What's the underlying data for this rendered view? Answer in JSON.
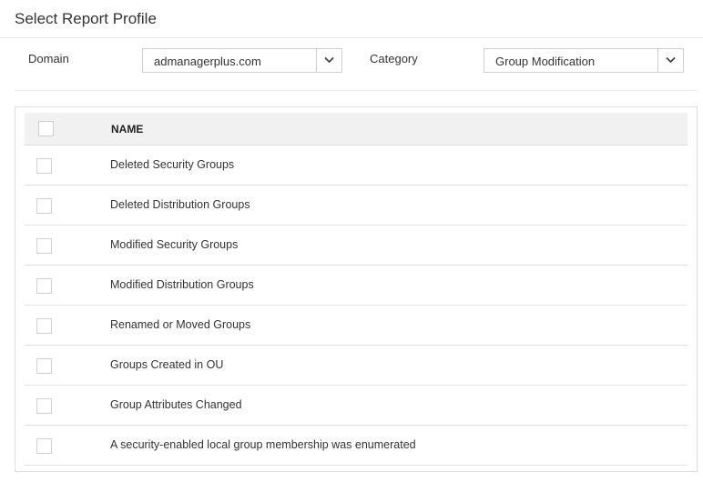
{
  "header": {
    "title": "Select Report Profile"
  },
  "filters": {
    "domain_label": "Domain",
    "domain_value": "admanagerplus.com",
    "category_label": "Category",
    "category_value": "Group Modification"
  },
  "table": {
    "column_name": "NAME",
    "rows": [
      "Deleted Security Groups",
      "Deleted Distribution Groups",
      "Modified Security Groups",
      "Modified Distribution Groups",
      "Renamed or Moved Groups",
      "Groups Created in OU",
      "Group Attributes Changed",
      "A security-enabled local group membership was enumerated"
    ]
  }
}
